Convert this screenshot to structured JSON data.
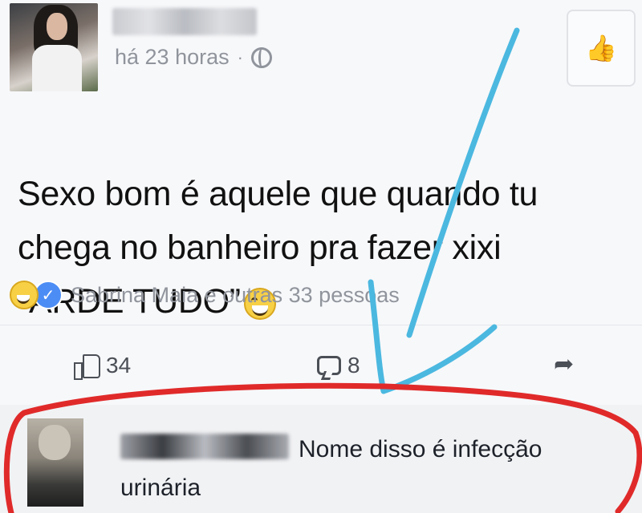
{
  "post": {
    "time": "há 23 horas",
    "separator": "·",
    "text": "Sexo bom é aquele que quando tu\nchega no banheiro pra fazer xixi\n“ARDE TUDO”",
    "reactions_summary": "Sabrina Maia e outras 33 pessoas",
    "like_count": "34",
    "comment_count": "8"
  },
  "comment": {
    "text": "Nome disso é infecção urinária"
  },
  "icons": {
    "privacy": "globe-icon",
    "page_like": "thumbs-up-icon",
    "like": "thumbs-up-icon",
    "comment": "comment-icon",
    "share": "share-arrow-icon",
    "reaction_haha": "haha-emoji-icon",
    "reaction_like": "like-reaction-icon"
  },
  "colors": {
    "arrow_annotation": "#4bb8e0",
    "circle_annotation": "#e02a2a",
    "meta_text": "#90949c"
  }
}
